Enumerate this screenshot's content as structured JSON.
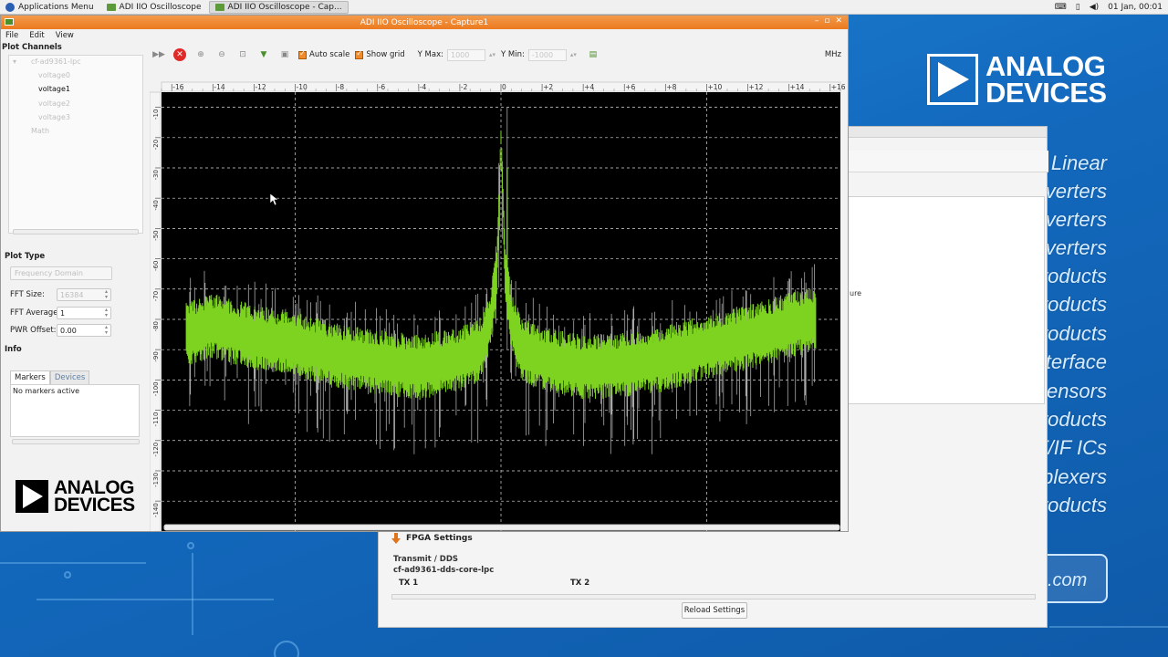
{
  "taskbar": {
    "apps_menu": "Applications Menu",
    "tasks": [
      "ADI IIO Oscilloscope",
      "ADI IIO Oscilloscope - Cap..."
    ],
    "clock": "01 Jan, 00:01"
  },
  "desktop": {
    "brand_line1": "ANALOG",
    "brand_line2": "DEVICES",
    "product_lines": [
      "Linear",
      "verters",
      "verters",
      "verters",
      "roducts",
      "roducts",
      "roducts",
      "terface",
      "Sensors",
      "roducts",
      "F/IF ICs",
      "plexers",
      "roducts"
    ],
    "dotcom": ".com"
  },
  "settings_window": {
    "partial_text": "ure",
    "fpga_settings": "FPGA Settings",
    "transmit_label": "Transmit / DDS",
    "core_name": "cf-ad9361-dds-core-lpc",
    "tx1": "TX 1",
    "tx2": "TX 2",
    "reload_button": "Reload Settings"
  },
  "osc_window": {
    "title": "ADI IIO Oscilloscope - Capture1",
    "menu": [
      "File",
      "Edit",
      "View"
    ],
    "plot_channels_title": "Plot Channels",
    "device": "cf-ad9361-lpc",
    "channels": [
      {
        "name": "voltage0",
        "enabled": false
      },
      {
        "name": "voltage1",
        "enabled": true
      },
      {
        "name": "voltage2",
        "enabled": false
      },
      {
        "name": "voltage3",
        "enabled": false
      }
    ],
    "math": "Math",
    "plot_type_title": "Plot Type",
    "plot_type_value": "Frequency Domain",
    "fft_size_label": "FFT Size:",
    "fft_size_value": "16384",
    "fft_avg_label": "FFT Average:",
    "fft_avg_value": "1",
    "pwr_offset_label": "PWR Offset:",
    "pwr_offset_value": "0.00",
    "info_title": "Info",
    "tabs": [
      "Markers",
      "Devices"
    ],
    "markers_text": "No markers active",
    "logo_line1": "ANALOG",
    "logo_line2": "DEVICES"
  },
  "toolbar": {
    "auto_scale_label": "Auto scale",
    "show_grid_label": "Show grid",
    "y_max_label": "Y Max:",
    "y_max_value": "1000",
    "y_min_label": "Y Min:",
    "y_min_value": "-1000",
    "unit_label": "MHz"
  },
  "chart_data": {
    "type": "line",
    "x_ticks": [
      -16,
      -14,
      -12,
      -10,
      -8,
      -6,
      -4,
      -2,
      0,
      2,
      4,
      6,
      8,
      10,
      12,
      14,
      16
    ],
    "y_ticks": [
      -10,
      -20,
      -30,
      -40,
      -50,
      -60,
      -70,
      -80,
      -90,
      -100,
      -110,
      -120,
      -130,
      -140,
      -150
    ],
    "xlim": [
      -16.5,
      16.5
    ],
    "ylim": [
      -152,
      -5
    ],
    "grid": true,
    "series": [
      {
        "color": "#7ed321",
        "x": [
          -15.3,
          -14,
          -12,
          -10,
          -8,
          -6,
          -4,
          -2,
          -1,
          -0.5,
          -0.2,
          0,
          0.2,
          0.5,
          1,
          2,
          4,
          6,
          8,
          10,
          12,
          14,
          15.3
        ],
        "center": [
          -85,
          -82,
          -86,
          -88,
          -92,
          -94,
          -96,
          -93,
          -90,
          -80,
          -65,
          -20,
          -65,
          -80,
          -90,
          -93,
          -96,
          -95,
          -93,
          -89,
          -86,
          -82,
          -80
        ],
        "spread": [
          9,
          9,
          9,
          9,
          9,
          9,
          9,
          9,
          9,
          8,
          8,
          3,
          8,
          8,
          9,
          9,
          9,
          9,
          9,
          9,
          9,
          9,
          9
        ]
      }
    ]
  }
}
